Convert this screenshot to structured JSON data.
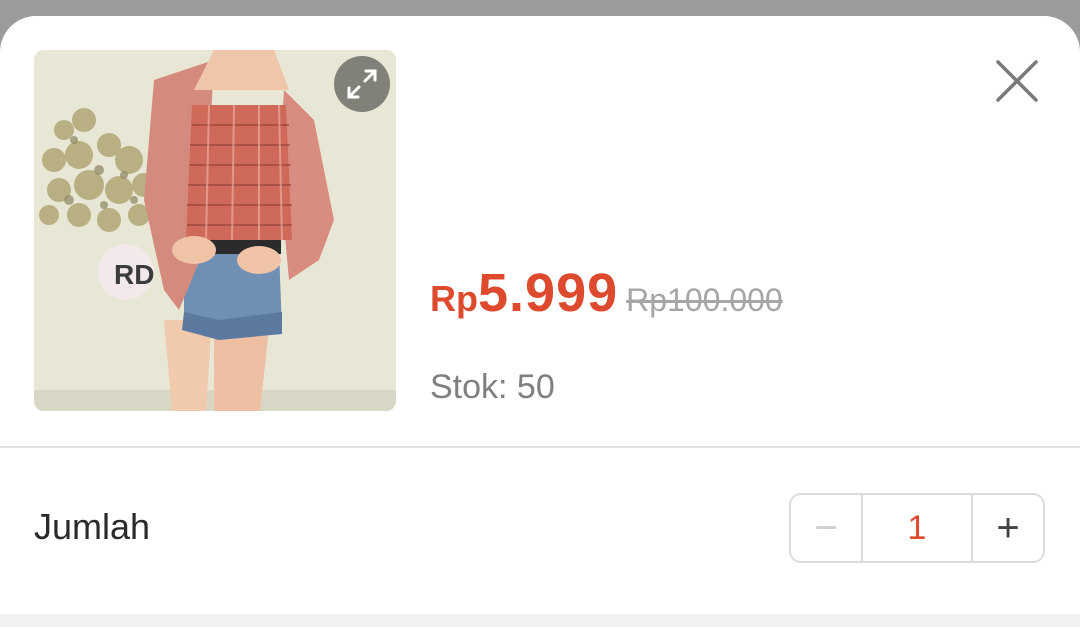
{
  "product": {
    "price_currency": "Rp",
    "price_value": "5.999",
    "original_price": "Rp100.000",
    "stock_label": "Stok: 50",
    "logo_text": "RD"
  },
  "quantity": {
    "label": "Jumlah",
    "value": "1",
    "minus_symbol": "−",
    "plus_symbol": "+"
  },
  "icons": {
    "expand": "expand-icon",
    "close": "close-icon"
  },
  "colors": {
    "accent": "#dd4a2e",
    "muted_text": "#7f7f7f",
    "strike_text": "#a6a6a6",
    "overlay": "#9b9b9b"
  }
}
